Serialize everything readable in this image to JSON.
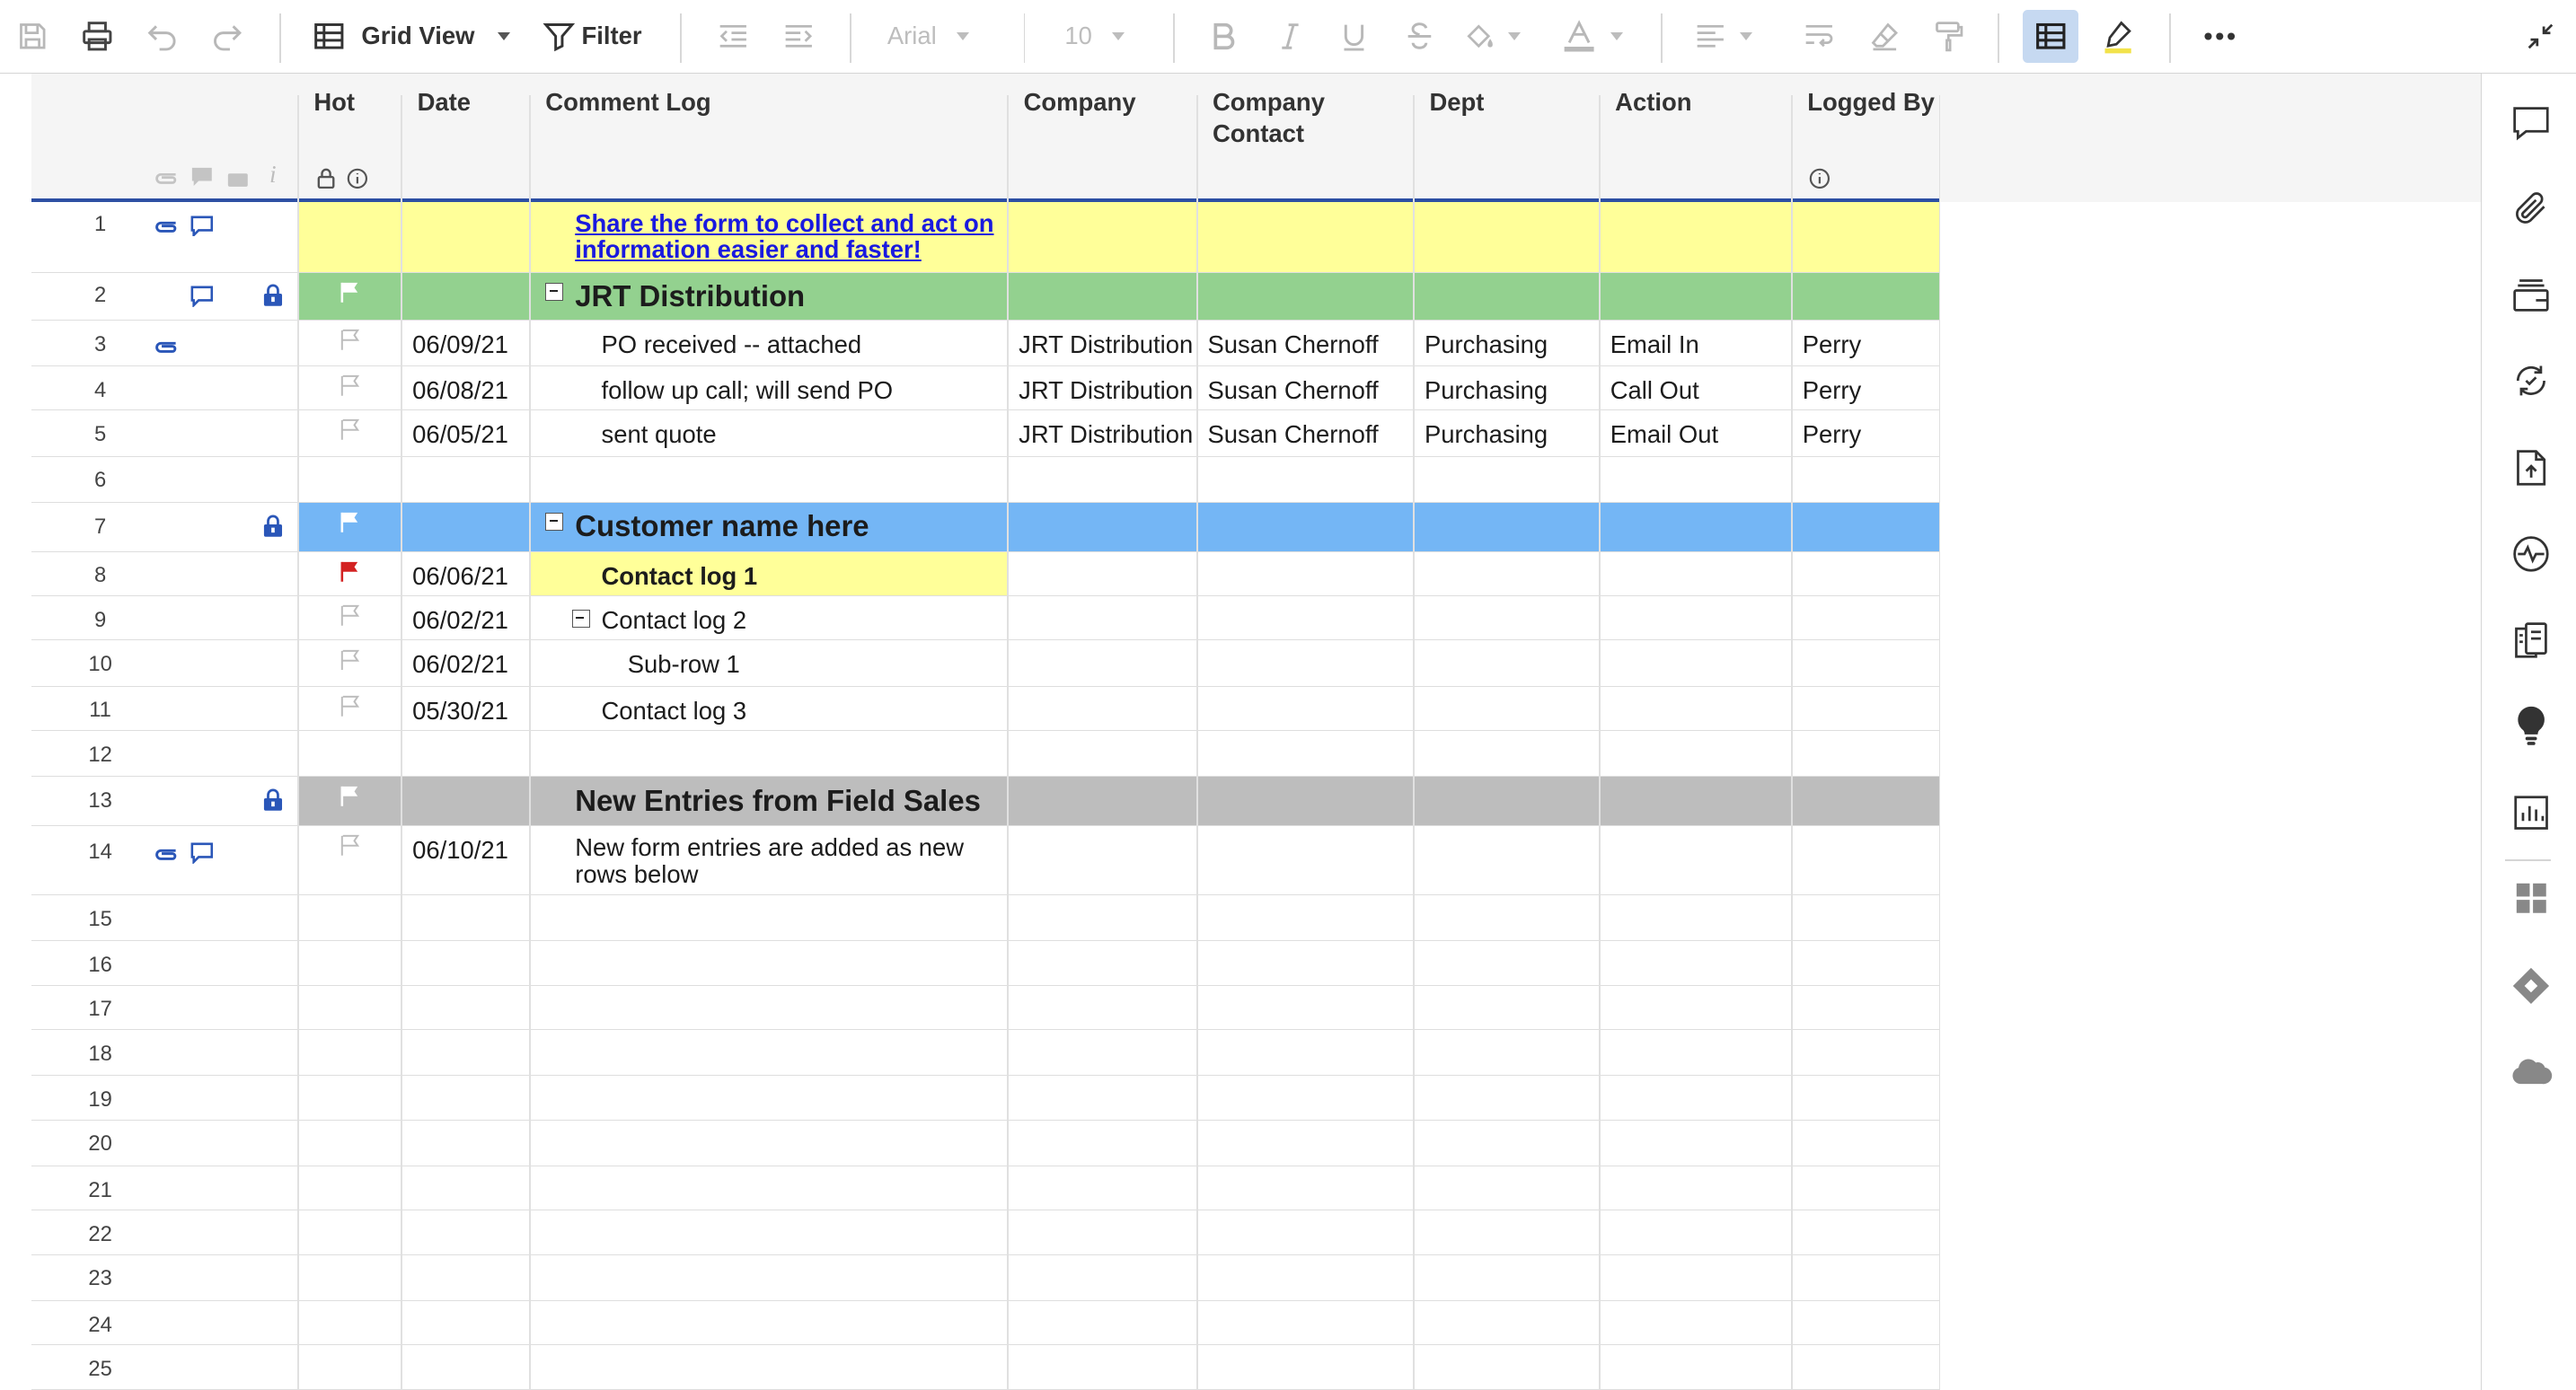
{
  "toolbar": {
    "view_label": "Grid View",
    "filter_label": "Filter",
    "font_name": "Arial",
    "font_size": "10"
  },
  "columns": {
    "hot": "Hot",
    "date": "Date",
    "comment_log": "Comment Log",
    "company": "Company",
    "company_contact_line1": "Company",
    "company_contact_line2": "Contact",
    "dept": "Dept",
    "action": "Action",
    "logged_by": "Logged By"
  },
  "row_numbers": [
    "1",
    "2",
    "3",
    "4",
    "5",
    "6",
    "7",
    "8",
    "9",
    "10",
    "11",
    "12",
    "13",
    "14",
    "15",
    "16",
    "17",
    "18",
    "19",
    "20",
    "21",
    "22",
    "23",
    "24",
    "25"
  ],
  "rows": {
    "r1": {
      "comment": "Share the form to collect and act on information easier and faster!"
    },
    "r2": {
      "comment": "JRT Distribution"
    },
    "r3": {
      "date": "06/09/21",
      "comment": "PO received -- attached",
      "company": "JRT Distribution",
      "contact": "Susan Chernoff",
      "dept": "Purchasing",
      "action": "Email In",
      "logged_by": "Perry"
    },
    "r4": {
      "date": "06/08/21",
      "comment": "follow up call; will send PO",
      "company": "JRT Distribution",
      "contact": "Susan Chernoff",
      "dept": "Purchasing",
      "action": "Call Out",
      "logged_by": "Perry"
    },
    "r5": {
      "date": "06/05/21",
      "comment": "sent quote",
      "company": "JRT Distribution",
      "contact": "Susan Chernoff",
      "dept": "Purchasing",
      "action": "Email Out",
      "logged_by": "Perry"
    },
    "r7": {
      "comment": "Customer name here"
    },
    "r8": {
      "date": "06/06/21",
      "comment": "Contact log 1"
    },
    "r9": {
      "date": "06/02/21",
      "comment": "Contact log 2"
    },
    "r10": {
      "date": "06/02/21",
      "comment": "Sub-row 1"
    },
    "r11": {
      "date": "05/30/21",
      "comment": "Contact log 3"
    },
    "r13": {
      "comment": "New Entries from Field Sales"
    },
    "r14": {
      "date": "06/10/21",
      "comment": "New form entries are added as new rows below"
    }
  },
  "colors": {
    "accent": "#2d4fa3",
    "yellow_row": "#ffff99",
    "green_row": "#93d18f",
    "blue_row": "#74b6f5",
    "gray_row": "#bdbdbd",
    "flag_red": "#d32222",
    "icon_blue": "#2a56b8"
  },
  "icons": {
    "toolbar": [
      "save-icon",
      "print-icon",
      "undo-icon",
      "redo-icon",
      "grid-view-icon",
      "filter-icon",
      "outdent-icon",
      "indent-icon",
      "bold-icon",
      "italic-icon",
      "underline-icon",
      "strikethrough-icon",
      "fill-color-icon",
      "text-color-icon",
      "align-icon",
      "wrap-text-icon",
      "clear-format-icon",
      "format-painter-icon",
      "grid-toggle-icon",
      "highlight-icon",
      "more-icon",
      "collapse-icon"
    ],
    "rightbar": [
      "comments-icon",
      "attachments-icon",
      "proofs-icon",
      "activity-log-icon",
      "upload-icon",
      "summary-icon",
      "forms-icon",
      "bulb-icon",
      "report-icon",
      "apps-icon",
      "jira-icon",
      "salesforce-icon"
    ]
  }
}
